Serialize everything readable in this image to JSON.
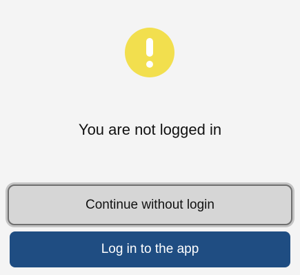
{
  "status": {
    "icon": "warning-exclamation-icon",
    "icon_color": "#f2df4e",
    "message": "You are not logged in"
  },
  "actions": {
    "continue_label": "Continue without login",
    "login_label": "Log in to the app",
    "primary_color": "#1f4d82"
  }
}
